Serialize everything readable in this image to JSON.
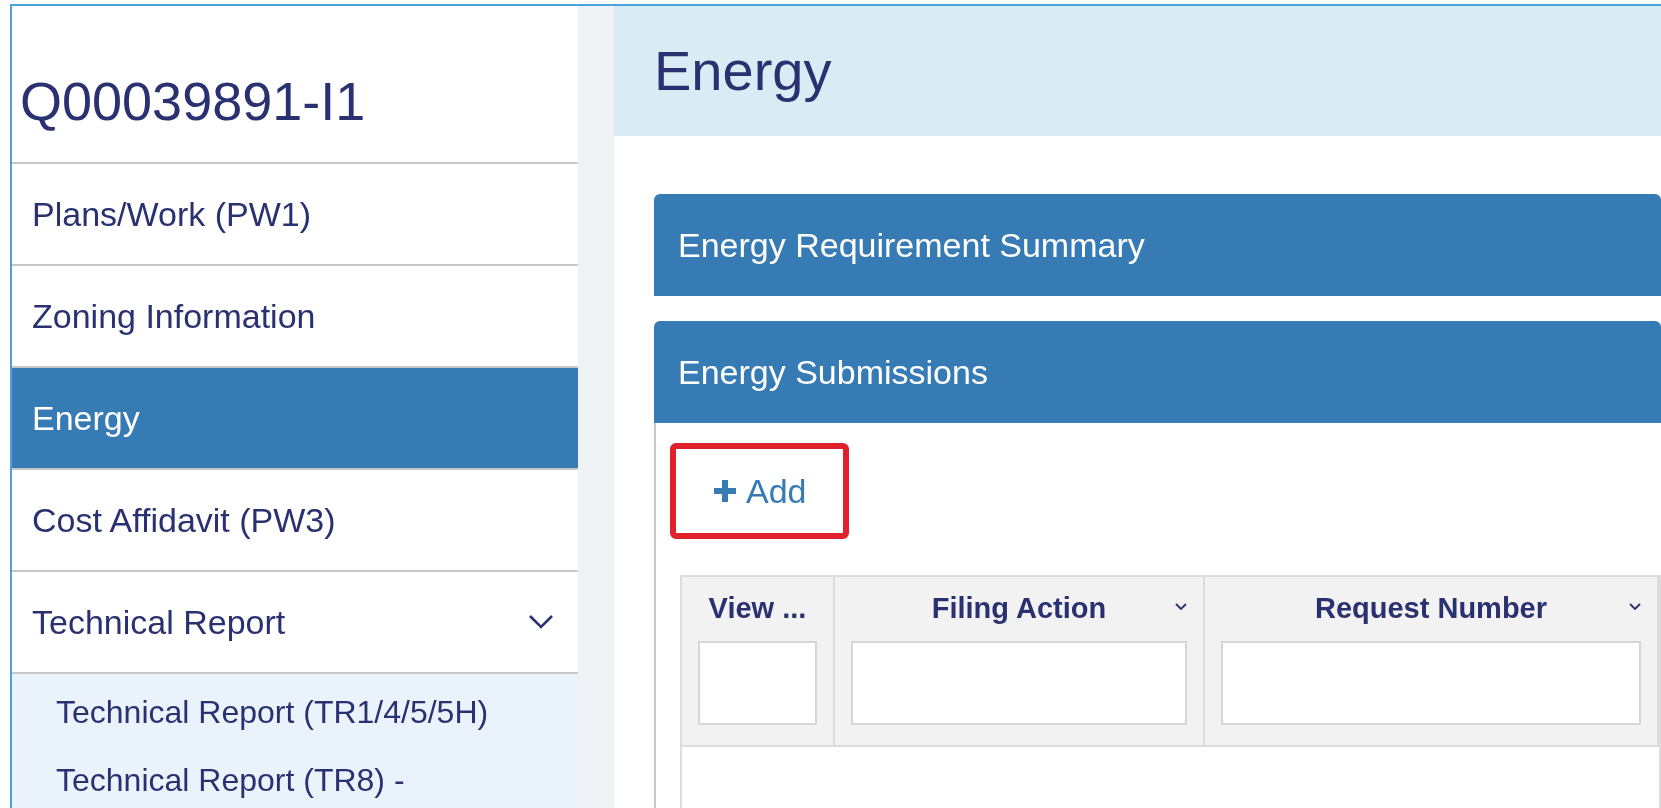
{
  "sidebar": {
    "title": "Q00039891-I1",
    "items": [
      {
        "label": "Plans/Work (PW1)",
        "selected": false
      },
      {
        "label": "Zoning Information",
        "selected": false
      },
      {
        "label": "Energy",
        "selected": true
      },
      {
        "label": "Cost Affidavit (PW3)",
        "selected": false
      },
      {
        "label": "Technical Report",
        "selected": false,
        "expanded": true,
        "children": [
          {
            "label": "Technical Report (TR1/4/5/5H)",
            "selected": false
          },
          {
            "label": "Technical Report (TR8) -",
            "selected": false
          }
        ]
      }
    ]
  },
  "main": {
    "title": "Energy",
    "panels": [
      {
        "title": "Energy Requirement Summary"
      },
      {
        "title": "Energy Submissions"
      }
    ],
    "add_button": {
      "label": "Add",
      "highlighted": true
    },
    "table": {
      "columns": [
        {
          "label": "View ...",
          "has_menu": false
        },
        {
          "label": "Filing Action",
          "has_menu": true
        },
        {
          "label": "Request Number",
          "has_menu": true
        }
      ]
    }
  }
}
